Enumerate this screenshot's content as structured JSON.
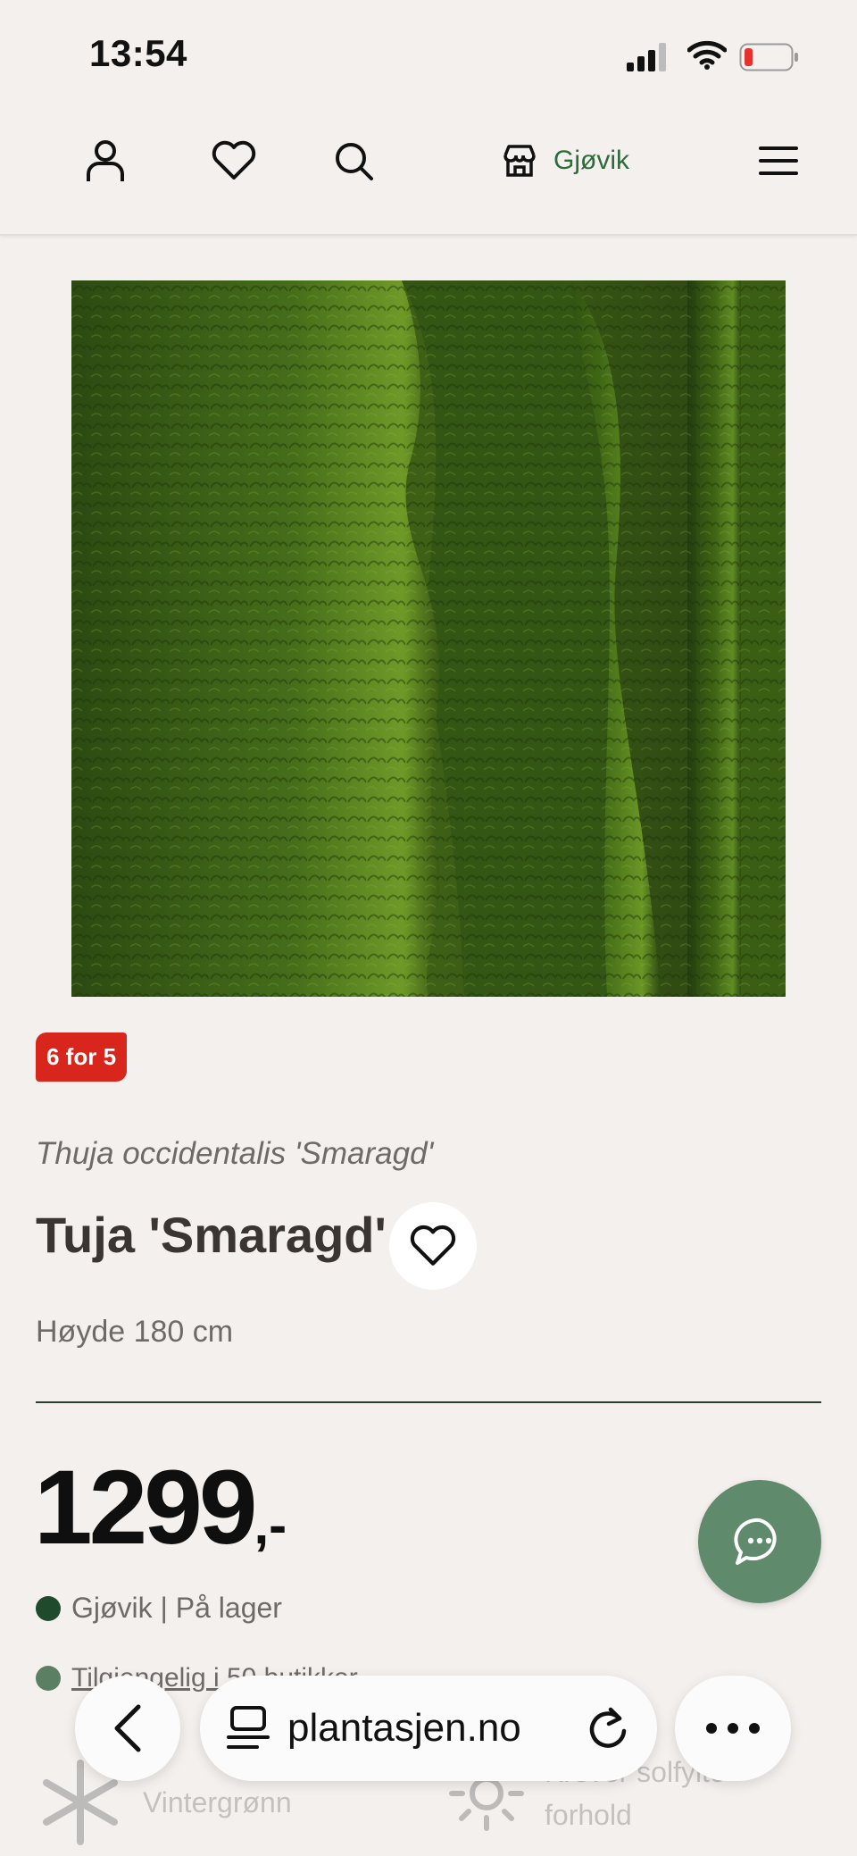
{
  "status": {
    "time": "13:54",
    "battery_color": "#e5322d"
  },
  "header": {
    "store": "Gjøvik",
    "icons": [
      "user-icon",
      "heart-icon",
      "search-icon",
      "store-icon",
      "menu-icon"
    ]
  },
  "product": {
    "promo": "6 for 5",
    "latin_name": "Thuja occidentalis 'Smaragd'",
    "name": "Tuja 'Smaragd'",
    "height": "Høyde 180 cm",
    "price": "1299",
    "price_suffix": ",-",
    "stock": "Gjøvik | På lager",
    "availability": "Tilgjengelig i 50 butikker"
  },
  "features": [
    {
      "label": "Vintergrønn",
      "icon": "snowflake-icon"
    },
    {
      "label": "Krever solfylte forhold",
      "icon": "sun-icon"
    }
  ],
  "browser": {
    "url": "plantasjen.no"
  },
  "colors": {
    "brand_green": "#2e6b3a",
    "promo_red": "#d9261c",
    "chat_green": "#5f8a6c",
    "background": "#f4f0ed"
  }
}
